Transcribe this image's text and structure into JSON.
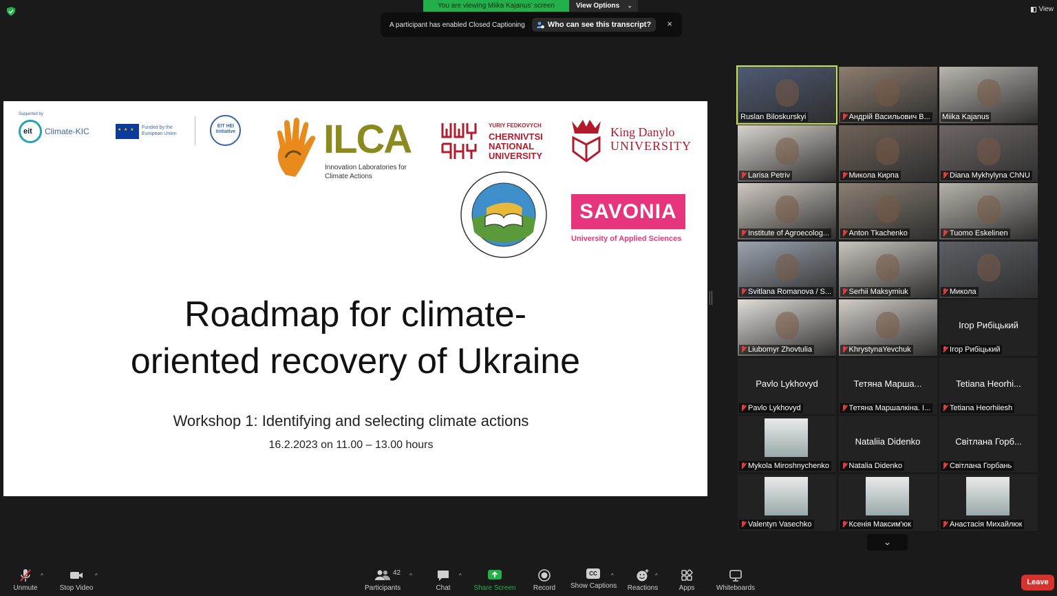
{
  "banner": {
    "viewing_text": "You are viewing Miika Kajanus' screen",
    "view_options_label": "View Options"
  },
  "cc_notice": {
    "message": "A participant has enabled Closed Captioning",
    "who_button": "Who can see this transcript?",
    "close": "×"
  },
  "view_button": "View",
  "slide": {
    "supported_by": "Supported by",
    "eit_short": "eit",
    "climate_kic": "Climate-KIC",
    "eu_text": "Funded by the European Union",
    "eit_hei": "EIT HEI Initiative",
    "ilca_title": "ILCA",
    "ilca_sub": "Innovation Laboratories for Climate Actions",
    "chnu_top": "YURIY FEDKOVYCH",
    "chnu_name": "CHERNIVTSI NATIONAL UNIVERSITY",
    "kdu_name_1": "King Danylo",
    "kdu_name_2": "UNIVERSITY",
    "savonia": "SAVONIA",
    "savonia_sub": "University of Applied Sciences",
    "title_line_1": "Roadmap for climate-",
    "title_line_2": "oriented recovery of Ukraine",
    "subtitle": "Workshop 1: Identifying and selecting climate actions",
    "date": "16.2.2023 on 11.00 – 13.00 hours"
  },
  "gallery": {
    "tiles": [
      {
        "label": "Ruslan Biloskurskyi",
        "muted": false,
        "active": true,
        "video": true,
        "bg": "#4e5a74"
      },
      {
        "label": "Андрій Васильович В...",
        "muted": true,
        "active": false,
        "video": true,
        "bg": "#8c7d6e"
      },
      {
        "label": "Miika Kajanus",
        "muted": false,
        "active": false,
        "video": true,
        "bg": "#b9b5ae"
      },
      {
        "label": "Larisa Petriv",
        "muted": true,
        "active": false,
        "video": true,
        "bg": "#d7d2cc"
      },
      {
        "label": "Микола Кирпа",
        "muted": true,
        "active": false,
        "video": true,
        "bg": "#6f6258"
      },
      {
        "label": "Diana Mykhylyna ChNU",
        "muted": true,
        "active": false,
        "video": true,
        "bg": "#6e6566"
      },
      {
        "label": "Institute of Agroecolog...",
        "muted": true,
        "active": false,
        "video": true,
        "bg": "#cfc8c0"
      },
      {
        "label": "Anton Tkachenko",
        "muted": true,
        "active": false,
        "video": true,
        "bg": "#8a7f72"
      },
      {
        "label": "Tuomo Eskelinen",
        "muted": true,
        "active": false,
        "video": true,
        "bg": "#b6b2aa"
      },
      {
        "label": "Svitlana Romanova / S...",
        "muted": true,
        "active": false,
        "video": true,
        "bg": "#9aa3ad"
      },
      {
        "label": "Serhii Maksymiuk",
        "muted": true,
        "active": false,
        "video": true,
        "bg": "#c8c4bd"
      },
      {
        "label": "Микола",
        "muted": true,
        "active": false,
        "video": true,
        "bg": "#5d5f66"
      },
      {
        "label": "Liubomyr Zhovtulia",
        "muted": true,
        "active": false,
        "video": true,
        "bg": "#e0ddd8"
      },
      {
        "label": "KhrystynaYevchuk",
        "muted": true,
        "active": false,
        "video": true,
        "bg": "#d2cdc8"
      },
      {
        "label": "Ігор Рибіцький",
        "center": "Ігор Рибіцький",
        "muted": true,
        "active": false,
        "video": false
      },
      {
        "label": "Pavlo Lykhovyd",
        "center": "Pavlo Lykhovyd",
        "muted": true,
        "active": false,
        "video": false
      },
      {
        "label": "Тетяна Маршалкіна. І...",
        "center": "Тетяна Марша...",
        "muted": true,
        "active": false,
        "video": false
      },
      {
        "label": "Tetiana Heorhiiesh",
        "center": "Tetiana Heorhi...",
        "muted": true,
        "active": false,
        "video": false
      },
      {
        "label": "Mykola Miroshnychenko",
        "muted": true,
        "active": false,
        "video": false,
        "pic": true
      },
      {
        "label": "Natalia Didenko",
        "center": "Nataliia Didenko",
        "muted": true,
        "active": false,
        "video": false
      },
      {
        "label": "Світлана Горбань",
        "center": "Світлана Горб...",
        "muted": true,
        "active": false,
        "video": false
      },
      {
        "label": "Valentyn Vasechko",
        "muted": true,
        "active": false,
        "video": false,
        "pic": true
      },
      {
        "label": "Ксенія Максим'юк",
        "muted": true,
        "active": false,
        "video": false,
        "pic": true
      },
      {
        "label": "Анастасія Михайлюк",
        "muted": true,
        "active": false,
        "video": false,
        "pic": true
      }
    ],
    "scroll_down": "⌄"
  },
  "toolbar": {
    "unmute": "Unmute",
    "stop_video": "Stop Video",
    "participants": "Participants",
    "participants_count": "42",
    "chat": "Chat",
    "share_screen": "Share Screen",
    "record": "Record",
    "show_captions": "Show Captions",
    "cc_glyph": "CC",
    "reactions": "Reactions",
    "apps": "Apps",
    "whiteboards": "Whiteboards",
    "leave": "Leave"
  },
  "colors": {
    "accent_green": "#23b04b",
    "active_speaker": "#c9e545",
    "leave_red": "#d8322f",
    "muted_red": "#e03e3e",
    "savonia_pink": "#e6357c"
  }
}
